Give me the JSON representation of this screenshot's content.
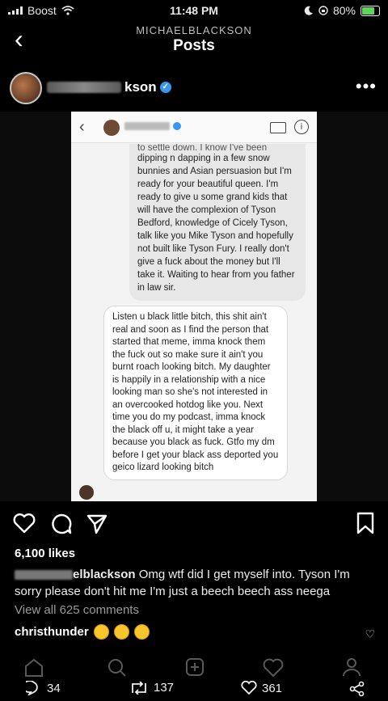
{
  "status": {
    "carrier": "Boost",
    "time": "11:48 PM",
    "battery": "80%"
  },
  "header": {
    "subtitle": "MICHAELBLACKSON",
    "title": "Posts"
  },
  "post": {
    "username_visible": "kson",
    "screenshot": {
      "bubble1_cutoff": "to settle down. I know I've been",
      "bubble1_text": "dipping n dapping in a few snow bunnies and Asian persuasion but I'm ready for your beautiful queen. I'm ready to give u some grand kids that will have the complexion of Tyson Bedford, knowledge of Cicely Tyson, talk like you Mike Tyson and hopefully not built like Tyson Fury. I really don't give a fuck about the money but I'll take it. Waiting to hear from you father in law sir.",
      "bubble2_text": "Listen u black little bitch, this shit ain't real and soon as I find the person that started that meme, imma knock them the fuck out so make sure it ain't you burnt roach looking bitch. My daughter is happily in a relationship with a nice looking man so she's not interested in an overcooked hotdog like you. Next time you do my podcast, imma knock the black off u, it might take a year because you black as fuck. Gtfo my dm before I get your black ass deported you geico lizard looking bitch"
    },
    "likes": "6,100 likes",
    "caption_user_visible": "elblackson",
    "caption_text": "Omg wtf did I get myself into. Tyson I'm sorry please don't hit me I'm just a beech beech ass neega",
    "view_all": "View all 625 comments",
    "comment_user": "christhunder"
  },
  "stats": {
    "comments": "34",
    "retweets": "137",
    "likes": "361"
  },
  "colors": {
    "background": "#000000",
    "verified": "#3897f0",
    "battery": "#5cd65c"
  }
}
